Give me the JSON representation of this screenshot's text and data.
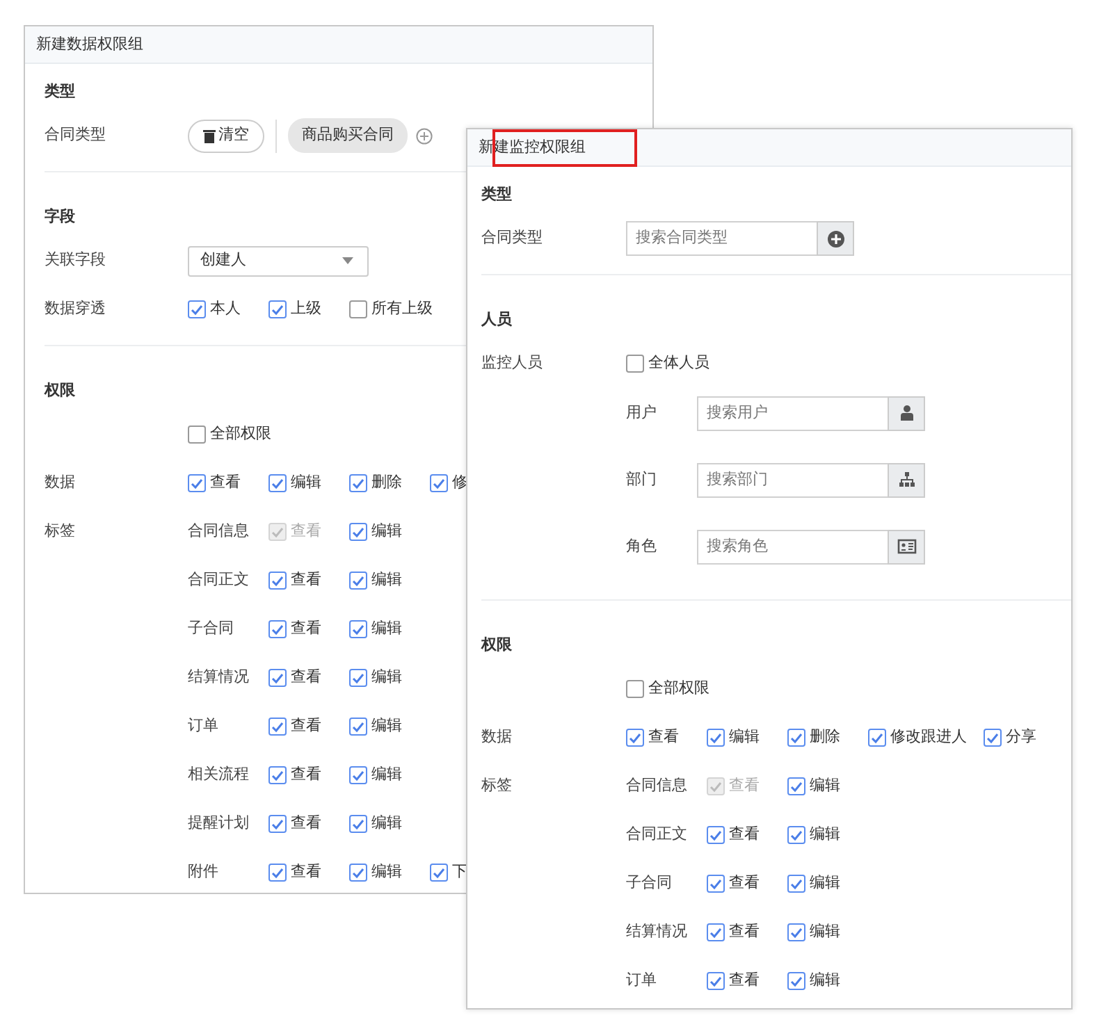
{
  "windows": [
    {
      "title": "新建数据权限组",
      "title_highlighted": false,
      "sections": [
        {
          "heading": "类型",
          "rows": [
            {
              "kind": "chips",
              "label": "合同类型",
              "clear_button": "清空",
              "chips": [
                "商品购买合同"
              ]
            }
          ]
        },
        {
          "heading": "字段",
          "rows": [
            {
              "kind": "select",
              "label": "关联字段",
              "value": "创建人"
            },
            {
              "kind": "checks",
              "label": "数据穿透",
              "options": [
                {
                  "label": "本人",
                  "checked": true,
                  "disabled": false
                },
                {
                  "label": "上级",
                  "checked": true,
                  "disabled": false
                },
                {
                  "label": "所有上级",
                  "checked": false,
                  "disabled": false
                }
              ]
            }
          ]
        },
        {
          "heading": "权限",
          "rows": [
            {
              "kind": "checks",
              "options": [
                {
                  "label": "全部权限",
                  "checked": false,
                  "disabled": false
                }
              ]
            },
            {
              "kind": "checks",
              "label": "数据",
              "options": [
                {
                  "label": "查看",
                  "checked": true,
                  "disabled": false
                },
                {
                  "label": "编辑",
                  "checked": true,
                  "disabled": false
                },
                {
                  "label": "删除",
                  "checked": true,
                  "disabled": false
                },
                {
                  "label": "修",
                  "checked": true,
                  "disabled": false
                }
              ]
            },
            {
              "kind": "tags",
              "label": "标签",
              "items": [
                {
                  "name": "合同信息",
                  "options": [
                    {
                      "label": "查看",
                      "checked": true,
                      "disabled": true
                    },
                    {
                      "label": "编辑",
                      "checked": true,
                      "disabled": false
                    }
                  ]
                },
                {
                  "name": "合同正文",
                  "options": [
                    {
                      "label": "查看",
                      "checked": true,
                      "disabled": false
                    },
                    {
                      "label": "编辑",
                      "checked": true,
                      "disabled": false
                    }
                  ]
                },
                {
                  "name": "子合同",
                  "options": [
                    {
                      "label": "查看",
                      "checked": true,
                      "disabled": false
                    },
                    {
                      "label": "编辑",
                      "checked": true,
                      "disabled": false
                    }
                  ]
                },
                {
                  "name": "结算情况",
                  "options": [
                    {
                      "label": "查看",
                      "checked": true,
                      "disabled": false
                    },
                    {
                      "label": "编辑",
                      "checked": true,
                      "disabled": false
                    }
                  ]
                },
                {
                  "name": "订单",
                  "options": [
                    {
                      "label": "查看",
                      "checked": true,
                      "disabled": false
                    },
                    {
                      "label": "编辑",
                      "checked": true,
                      "disabled": false
                    }
                  ]
                },
                {
                  "name": "相关流程",
                  "options": [
                    {
                      "label": "查看",
                      "checked": true,
                      "disabled": false
                    },
                    {
                      "label": "编辑",
                      "checked": true,
                      "disabled": false
                    }
                  ]
                },
                {
                  "name": "提醒计划",
                  "options": [
                    {
                      "label": "查看",
                      "checked": true,
                      "disabled": false
                    },
                    {
                      "label": "编辑",
                      "checked": true,
                      "disabled": false
                    }
                  ]
                },
                {
                  "name": "附件",
                  "options": [
                    {
                      "label": "查看",
                      "checked": true,
                      "disabled": false
                    },
                    {
                      "label": "编辑",
                      "checked": true,
                      "disabled": false
                    },
                    {
                      "label": "下",
                      "checked": true,
                      "disabled": false
                    }
                  ]
                }
              ]
            }
          ]
        }
      ]
    },
    {
      "title": "新建监控权限组",
      "title_highlighted": true,
      "sections": [
        {
          "heading": "类型",
          "rows": [
            {
              "kind": "type-search",
              "label": "合同类型",
              "placeholder": "搜索合同类型"
            }
          ]
        },
        {
          "heading": "人员",
          "rows": [
            {
              "kind": "checks",
              "label": "监控人员",
              "options": [
                {
                  "label": "全体人员",
                  "checked": false,
                  "disabled": false
                }
              ]
            },
            {
              "kind": "user-search",
              "sublabel": "用户",
              "placeholder": "搜索用户"
            },
            {
              "kind": "department-search",
              "sublabel": "部门",
              "placeholder": "搜索部门"
            },
            {
              "kind": "role-search",
              "sublabel": "角色",
              "placeholder": "搜索角色"
            }
          ]
        },
        {
          "heading": "权限",
          "rows": [
            {
              "kind": "checks",
              "options": [
                {
                  "label": "全部权限",
                  "checked": false,
                  "disabled": false
                }
              ]
            },
            {
              "kind": "checks",
              "label": "数据",
              "options": [
                {
                  "label": "查看",
                  "checked": true,
                  "disabled": false
                },
                {
                  "label": "编辑",
                  "checked": true,
                  "disabled": false
                },
                {
                  "label": "删除",
                  "checked": true,
                  "disabled": false
                },
                {
                  "label": "修改跟进人",
                  "checked": true,
                  "disabled": false
                },
                {
                  "label": "分享",
                  "checked": true,
                  "disabled": false
                }
              ]
            },
            {
              "kind": "tags",
              "label": "标签",
              "items": [
                {
                  "name": "合同信息",
                  "options": [
                    {
                      "label": "查看",
                      "checked": true,
                      "disabled": true
                    },
                    {
                      "label": "编辑",
                      "checked": true,
                      "disabled": false
                    }
                  ]
                },
                {
                  "name": "合同正文",
                  "options": [
                    {
                      "label": "查看",
                      "checked": true,
                      "disabled": false
                    },
                    {
                      "label": "编辑",
                      "checked": true,
                      "disabled": false
                    }
                  ]
                },
                {
                  "name": "子合同",
                  "options": [
                    {
                      "label": "查看",
                      "checked": true,
                      "disabled": false
                    },
                    {
                      "label": "编辑",
                      "checked": true,
                      "disabled": false
                    }
                  ]
                },
                {
                  "name": "结算情况",
                  "options": [
                    {
                      "label": "查看",
                      "checked": true,
                      "disabled": false
                    },
                    {
                      "label": "编辑",
                      "checked": true,
                      "disabled": false
                    }
                  ]
                },
                {
                  "name": "订单",
                  "options": [
                    {
                      "label": "查看",
                      "checked": true,
                      "disabled": false
                    },
                    {
                      "label": "编辑",
                      "checked": true,
                      "disabled": false
                    }
                  ]
                }
              ]
            }
          ]
        }
      ]
    }
  ]
}
